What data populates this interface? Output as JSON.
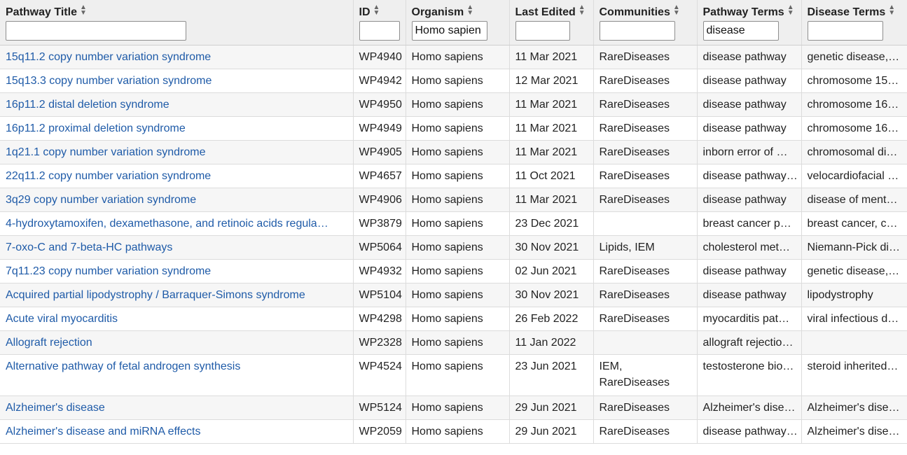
{
  "columns": [
    {
      "label": "Pathway Title",
      "filter": ""
    },
    {
      "label": "ID",
      "filter": ""
    },
    {
      "label": "Organism",
      "filter": "Homo sapien"
    },
    {
      "label": "Last Edited",
      "filter": ""
    },
    {
      "label": "Communities",
      "filter": ""
    },
    {
      "label": "Pathway Terms",
      "filter": "disease"
    },
    {
      "label": "Disease Terms",
      "filter": ""
    }
  ],
  "rows": [
    {
      "title": "15q11.2 copy number variation syndrome",
      "id": "WP4940",
      "organism": "Homo sapiens",
      "edited": "11 Mar 2021",
      "communities": "RareDiseases",
      "pathway_terms": "disease pathway",
      "disease_terms": "genetic disease,…"
    },
    {
      "title": "15q13.3 copy number variation syndrome",
      "id": "WP4942",
      "organism": "Homo sapiens",
      "edited": "12 Mar 2021",
      "communities": "RareDiseases",
      "pathway_terms": "disease pathway",
      "disease_terms": "chromosome 15…"
    },
    {
      "title": "16p11.2 distal deletion syndrome",
      "id": "WP4950",
      "organism": "Homo sapiens",
      "edited": "11 Mar 2021",
      "communities": "RareDiseases",
      "pathway_terms": "disease pathway",
      "disease_terms": "chromosome 16…"
    },
    {
      "title": "16p11.2 proximal deletion syndrome",
      "id": "WP4949",
      "organism": "Homo sapiens",
      "edited": "11 Mar 2021",
      "communities": "RareDiseases",
      "pathway_terms": "disease pathway",
      "disease_terms": "chromosome 16…"
    },
    {
      "title": "1q21.1 copy number variation syndrome",
      "id": "WP4905",
      "organism": "Homo sapiens",
      "edited": "11 Mar 2021",
      "communities": "RareDiseases",
      "pathway_terms": "inborn error of …",
      "disease_terms": "chromosomal di…"
    },
    {
      "title": "22q11.2 copy number variation syndrome",
      "id": "WP4657",
      "organism": "Homo sapiens",
      "edited": "11 Oct 2021",
      "communities": "RareDiseases",
      "pathway_terms": "disease pathway…",
      "disease_terms": "velocardiofacial …"
    },
    {
      "title": "3q29 copy number variation syndrome",
      "id": "WP4906",
      "organism": "Homo sapiens",
      "edited": "11 Mar 2021",
      "communities": "RareDiseases",
      "pathway_terms": "disease pathway",
      "disease_terms": "disease of ment…"
    },
    {
      "title": "4-hydroxytamoxifen, dexamethasone, and retinoic acids regula…",
      "id": "WP3879",
      "organism": "Homo sapiens",
      "edited": "23 Dec 2021",
      "communities": "",
      "pathway_terms": "breast cancer p…",
      "disease_terms": "breast cancer, c…"
    },
    {
      "title": "7-oxo-C and 7-beta-HC pathways",
      "id": "WP5064",
      "organism": "Homo sapiens",
      "edited": "30 Nov 2021",
      "communities": "Lipids, IEM",
      "pathway_terms": "cholesterol met…",
      "disease_terms": "Niemann-Pick di…"
    },
    {
      "title": "7q11.23 copy number variation syndrome",
      "id": "WP4932",
      "organism": "Homo sapiens",
      "edited": "02 Jun 2021",
      "communities": "RareDiseases",
      "pathway_terms": "disease pathway",
      "disease_terms": "genetic disease,…"
    },
    {
      "title": "Acquired partial lipodystrophy / Barraquer-Simons syndrome",
      "id": "WP5104",
      "organism": "Homo sapiens",
      "edited": "30 Nov 2021",
      "communities": "RareDiseases",
      "pathway_terms": "disease pathway",
      "disease_terms": "lipodystrophy"
    },
    {
      "title": "Acute viral myocarditis",
      "id": "WP4298",
      "organism": "Homo sapiens",
      "edited": "26 Feb 2022",
      "communities": "RareDiseases",
      "pathway_terms": "myocarditis pat…",
      "disease_terms": "viral infectious d…"
    },
    {
      "title": "Allograft rejection",
      "id": "WP2328",
      "organism": "Homo sapiens",
      "edited": "11 Jan 2022",
      "communities": "",
      "pathway_terms": "allograft rejectio…",
      "disease_terms": ""
    },
    {
      "title": "Alternative pathway of fetal androgen synthesis",
      "id": "WP4524",
      "organism": "Homo sapiens",
      "edited": "23 Jun 2021",
      "communities": "IEM, RareDiseases",
      "pathway_terms": "testosterone bio…",
      "disease_terms": "steroid inherited…"
    },
    {
      "title": "Alzheimer's disease",
      "id": "WP5124",
      "organism": "Homo sapiens",
      "edited": "29 Jun 2021",
      "communities": "RareDiseases",
      "pathway_terms": "Alzheimer's dise…",
      "disease_terms": "Alzheimer's dise…"
    },
    {
      "title": "Alzheimer's disease and miRNA effects",
      "id": "WP2059",
      "organism": "Homo sapiens",
      "edited": "29 Jun 2021",
      "communities": "RareDiseases",
      "pathway_terms": "disease pathway…",
      "disease_terms": "Alzheimer's dise…"
    }
  ]
}
